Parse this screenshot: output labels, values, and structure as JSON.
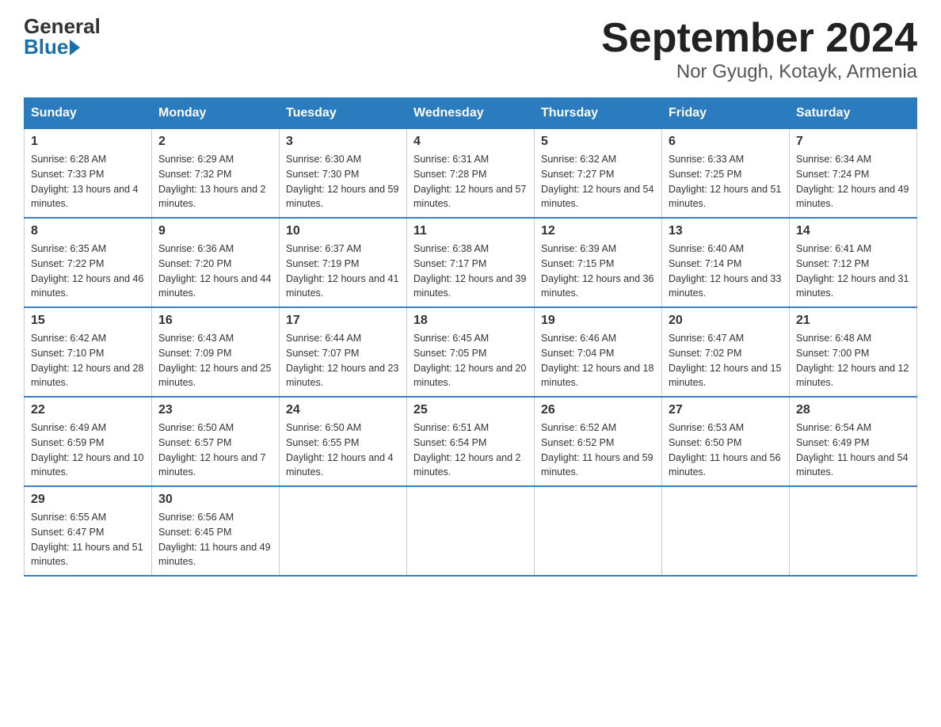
{
  "logo": {
    "general": "General",
    "blue": "Blue"
  },
  "title": "September 2024",
  "subtitle": "Nor Gyugh, Kotayk, Armenia",
  "days_of_week": [
    "Sunday",
    "Monday",
    "Tuesday",
    "Wednesday",
    "Thursday",
    "Friday",
    "Saturday"
  ],
  "weeks": [
    [
      {
        "day": "1",
        "sunrise": "6:28 AM",
        "sunset": "7:33 PM",
        "daylight": "13 hours and 4 minutes."
      },
      {
        "day": "2",
        "sunrise": "6:29 AM",
        "sunset": "7:32 PM",
        "daylight": "13 hours and 2 minutes."
      },
      {
        "day": "3",
        "sunrise": "6:30 AM",
        "sunset": "7:30 PM",
        "daylight": "12 hours and 59 minutes."
      },
      {
        "day": "4",
        "sunrise": "6:31 AM",
        "sunset": "7:28 PM",
        "daylight": "12 hours and 57 minutes."
      },
      {
        "day": "5",
        "sunrise": "6:32 AM",
        "sunset": "7:27 PM",
        "daylight": "12 hours and 54 minutes."
      },
      {
        "day": "6",
        "sunrise": "6:33 AM",
        "sunset": "7:25 PM",
        "daylight": "12 hours and 51 minutes."
      },
      {
        "day": "7",
        "sunrise": "6:34 AM",
        "sunset": "7:24 PM",
        "daylight": "12 hours and 49 minutes."
      }
    ],
    [
      {
        "day": "8",
        "sunrise": "6:35 AM",
        "sunset": "7:22 PM",
        "daylight": "12 hours and 46 minutes."
      },
      {
        "day": "9",
        "sunrise": "6:36 AM",
        "sunset": "7:20 PM",
        "daylight": "12 hours and 44 minutes."
      },
      {
        "day": "10",
        "sunrise": "6:37 AM",
        "sunset": "7:19 PM",
        "daylight": "12 hours and 41 minutes."
      },
      {
        "day": "11",
        "sunrise": "6:38 AM",
        "sunset": "7:17 PM",
        "daylight": "12 hours and 39 minutes."
      },
      {
        "day": "12",
        "sunrise": "6:39 AM",
        "sunset": "7:15 PM",
        "daylight": "12 hours and 36 minutes."
      },
      {
        "day": "13",
        "sunrise": "6:40 AM",
        "sunset": "7:14 PM",
        "daylight": "12 hours and 33 minutes."
      },
      {
        "day": "14",
        "sunrise": "6:41 AM",
        "sunset": "7:12 PM",
        "daylight": "12 hours and 31 minutes."
      }
    ],
    [
      {
        "day": "15",
        "sunrise": "6:42 AM",
        "sunset": "7:10 PM",
        "daylight": "12 hours and 28 minutes."
      },
      {
        "day": "16",
        "sunrise": "6:43 AM",
        "sunset": "7:09 PM",
        "daylight": "12 hours and 25 minutes."
      },
      {
        "day": "17",
        "sunrise": "6:44 AM",
        "sunset": "7:07 PM",
        "daylight": "12 hours and 23 minutes."
      },
      {
        "day": "18",
        "sunrise": "6:45 AM",
        "sunset": "7:05 PM",
        "daylight": "12 hours and 20 minutes."
      },
      {
        "day": "19",
        "sunrise": "6:46 AM",
        "sunset": "7:04 PM",
        "daylight": "12 hours and 18 minutes."
      },
      {
        "day": "20",
        "sunrise": "6:47 AM",
        "sunset": "7:02 PM",
        "daylight": "12 hours and 15 minutes."
      },
      {
        "day": "21",
        "sunrise": "6:48 AM",
        "sunset": "7:00 PM",
        "daylight": "12 hours and 12 minutes."
      }
    ],
    [
      {
        "day": "22",
        "sunrise": "6:49 AM",
        "sunset": "6:59 PM",
        "daylight": "12 hours and 10 minutes."
      },
      {
        "day": "23",
        "sunrise": "6:50 AM",
        "sunset": "6:57 PM",
        "daylight": "12 hours and 7 minutes."
      },
      {
        "day": "24",
        "sunrise": "6:50 AM",
        "sunset": "6:55 PM",
        "daylight": "12 hours and 4 minutes."
      },
      {
        "day": "25",
        "sunrise": "6:51 AM",
        "sunset": "6:54 PM",
        "daylight": "12 hours and 2 minutes."
      },
      {
        "day": "26",
        "sunrise": "6:52 AM",
        "sunset": "6:52 PM",
        "daylight": "11 hours and 59 minutes."
      },
      {
        "day": "27",
        "sunrise": "6:53 AM",
        "sunset": "6:50 PM",
        "daylight": "11 hours and 56 minutes."
      },
      {
        "day": "28",
        "sunrise": "6:54 AM",
        "sunset": "6:49 PM",
        "daylight": "11 hours and 54 minutes."
      }
    ],
    [
      {
        "day": "29",
        "sunrise": "6:55 AM",
        "sunset": "6:47 PM",
        "daylight": "11 hours and 51 minutes."
      },
      {
        "day": "30",
        "sunrise": "6:56 AM",
        "sunset": "6:45 PM",
        "daylight": "11 hours and 49 minutes."
      },
      null,
      null,
      null,
      null,
      null
    ]
  ]
}
